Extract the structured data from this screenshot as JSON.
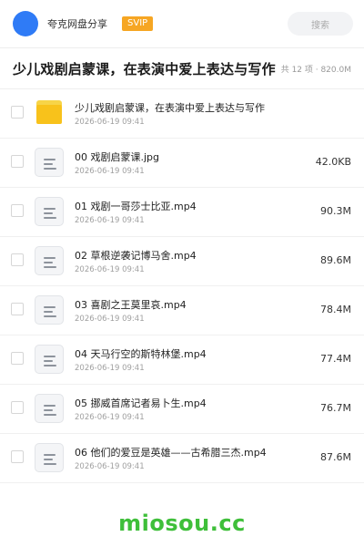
{
  "header": {
    "site_name": "夸克网盘分享",
    "badge": "SVIP",
    "search_placeholder": "搜索",
    "avatar_color": "#2f7bf6",
    "badge_color": "#f6a623"
  },
  "folder": {
    "title": "少儿戏剧启蒙课，在表演中爱上表达与写作",
    "summary": "共 12 项 · 820.0M"
  },
  "files": [
    {
      "name": "少儿戏剧启蒙课，在表演中爱上表达与写作",
      "date": "2026-06-19 09:41",
      "size": "",
      "icon": "folder-icon"
    },
    {
      "name": "00 戏剧启蒙课.jpg",
      "date": "2026-06-19 09:41",
      "size": "42.0KB",
      "icon": "document-icon"
    },
    {
      "name": "01 戏剧一哥莎士比亚.mp4",
      "date": "2026-06-19 09:41",
      "size": "90.3M",
      "icon": "document-icon"
    },
    {
      "name": "02 草根逆袭记博马舍.mp4",
      "date": "2026-06-19 09:41",
      "size": "89.6M",
      "icon": "document-icon"
    },
    {
      "name": "03 喜剧之王莫里哀.mp4",
      "date": "2026-06-19 09:41",
      "size": "78.4M",
      "icon": "document-icon"
    },
    {
      "name": "04 天马行空的斯特林堡.mp4",
      "date": "2026-06-19 09:41",
      "size": "77.4M",
      "icon": "document-icon"
    },
    {
      "name": "05 挪威首席记者易卜生.mp4",
      "date": "2026-06-19 09:41",
      "size": "76.7M",
      "icon": "document-icon"
    },
    {
      "name": "06 他们的爱豆是英雄——古希腊三杰.mp4",
      "date": "2026-06-19 09:41",
      "size": "87.6M",
      "icon": "document-icon"
    }
  ],
  "footer": {
    "watermark": "miosou.cc",
    "watermark_color": "#3fbf3a"
  }
}
